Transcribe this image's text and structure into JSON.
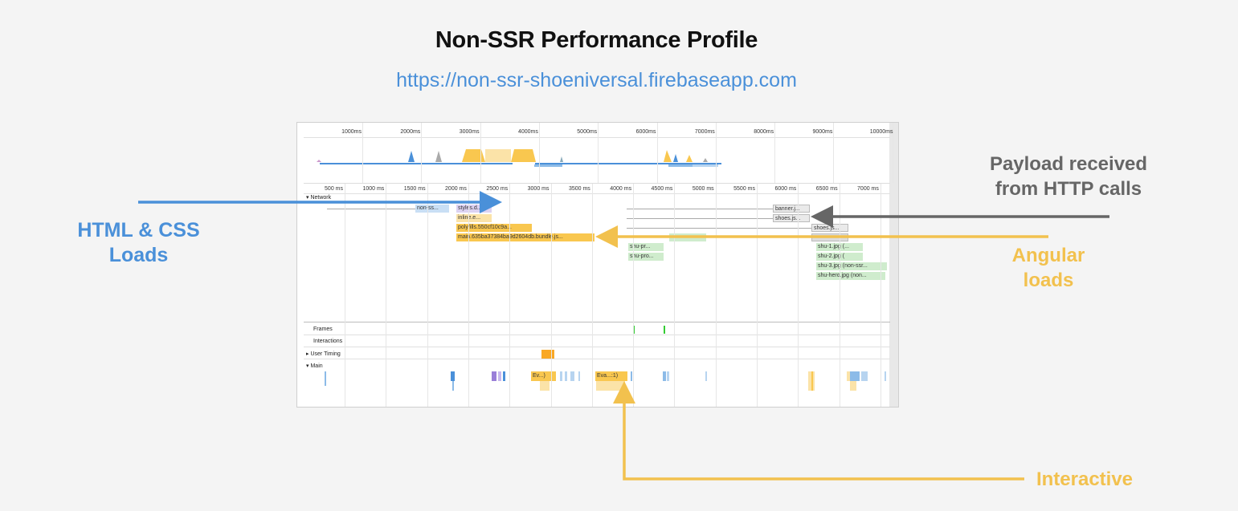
{
  "header": {
    "title": "Non-SSR Performance Profile",
    "url": "https://non-ssr-shoeniversal.firebaseapp.com"
  },
  "annotations": {
    "html_css": "HTML & CSS\nLoads",
    "payload": "Payload received\nfrom HTTP calls",
    "angular": "Angular\nloads",
    "interactive": "Interactive"
  },
  "colors": {
    "blue": "#4a90d9",
    "gray": "#666666",
    "yellow": "#f2c14e"
  },
  "overview_ticks": [
    "1000ms",
    "2000ms",
    "3000ms",
    "4000ms",
    "5000ms",
    "6000ms",
    "7000ms",
    "8000ms",
    "9000ms",
    "10000ms"
  ],
  "network_ticks": [
    "500 ms",
    "1000 ms",
    "1500 ms",
    "2000 ms",
    "2500 ms",
    "3000 ms",
    "3500 ms",
    "4000 ms",
    "4500 ms",
    "5000 ms",
    "5500 ms",
    "6000 ms",
    "6500 ms",
    "7000 ms"
  ],
  "tracks": {
    "network": "Network",
    "frames": "Frames",
    "interactions": "Interactions",
    "user_timing": "User Timing",
    "main": "Main"
  },
  "requests": [
    {
      "label": "non-ss...",
      "color": "blue"
    },
    {
      "label": "styles.d...",
      "color": "purple"
    },
    {
      "label": "inline.e...",
      "color": "lyellow"
    },
    {
      "label": "polyfills.550cf10c9a...",
      "color": "yellow"
    },
    {
      "label": "main.635ba37384ba9d2604db.bundle.js...",
      "color": "yellow"
    },
    {
      "label": "banner.j...",
      "color": "gray"
    },
    {
      "label": "shoes.js...",
      "color": "gray"
    },
    {
      "label": "shoes.js...",
      "color": "gray"
    },
    {
      "label": "shu-pr...",
      "color": "green"
    },
    {
      "label": "shu-pro...",
      "color": "green"
    },
    {
      "label": "shu-1.jpg (...",
      "color": "green"
    },
    {
      "label": "shu-2.jpg (",
      "color": "green"
    },
    {
      "label": "shu-3.jpg (non-ssr...",
      "color": "green"
    },
    {
      "label": "shu-hero.jpg (non...",
      "color": "green"
    }
  ],
  "main_tasks": [
    {
      "label": "Ev...)"
    },
    {
      "label": "Eva...:1)"
    }
  ]
}
